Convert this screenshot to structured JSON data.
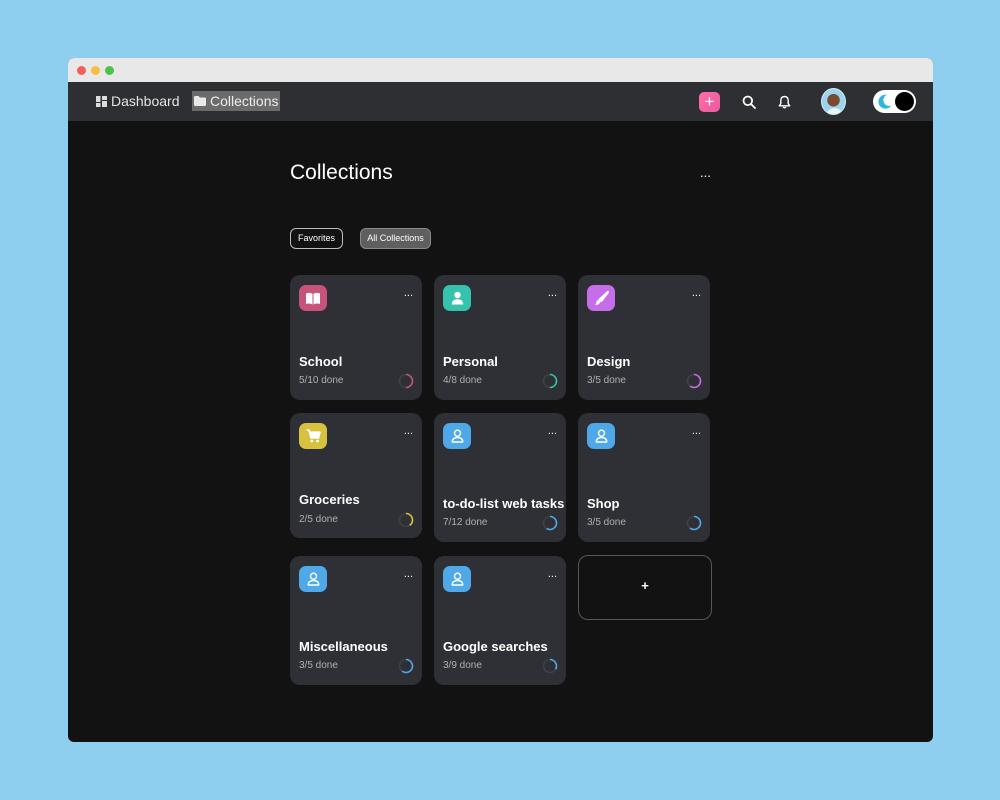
{
  "nav": {
    "dashboard_label": "Dashboard",
    "collections_label": "Collections",
    "add_label": "+"
  },
  "page": {
    "title": "Collections",
    "more_label": "..."
  },
  "filters": {
    "favorites_label": "Favorites",
    "all_label": "All Collections"
  },
  "collections": [
    {
      "title": "School",
      "progress": "5/10 done",
      "done": 5,
      "total": 10,
      "color": "#c7537b",
      "icon": "book-icon"
    },
    {
      "title": "Personal",
      "progress": "4/8 done",
      "done": 4,
      "total": 8,
      "color": "#35c3ad",
      "icon": "person-icon"
    },
    {
      "title": "Design",
      "progress": "3/5 done",
      "done": 3,
      "total": 5,
      "color": "#c66ee9",
      "icon": "brush-icon"
    },
    {
      "title": "Groceries",
      "progress": "2/5 done",
      "done": 2,
      "total": 5,
      "color": "#d8c13f",
      "icon": "cart-icon"
    },
    {
      "title": "to-do-list web tasks",
      "progress": "7/12 done",
      "done": 7,
      "total": 12,
      "color": "#4fa8e7",
      "icon": "user-icon"
    },
    {
      "title": "Shop",
      "progress": "3/5 done",
      "done": 3,
      "total": 5,
      "color": "#4fa8e7",
      "icon": "user-icon"
    },
    {
      "title": "Miscellaneous",
      "progress": "3/5 done",
      "done": 3,
      "total": 5,
      "color": "#4fa8e7",
      "icon": "user-icon"
    },
    {
      "title": "Google searches",
      "progress": "3/9 done",
      "done": 3,
      "total": 9,
      "color": "#4fa8e7",
      "icon": "user-icon"
    }
  ],
  "add_card_label": "+",
  "card_more_label": "..."
}
